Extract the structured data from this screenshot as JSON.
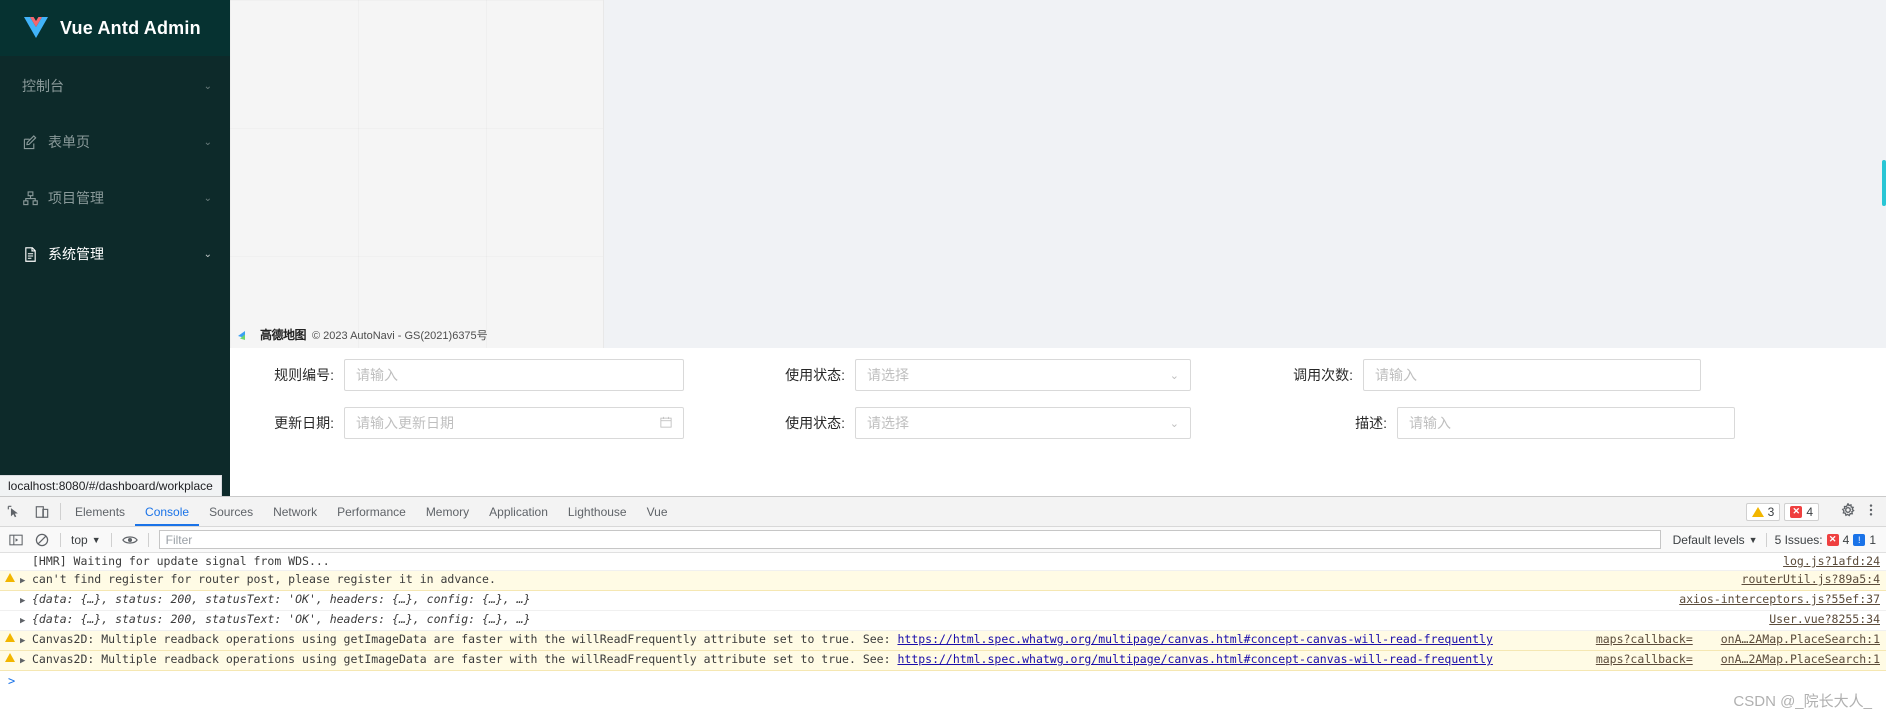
{
  "app": {
    "logo_title": "Vue Antd Admin",
    "logo_icon": "vue-logo-icon",
    "status_url": "localhost:8080/#/dashboard/workplace"
  },
  "sidebar": {
    "items": [
      {
        "label": "控制台",
        "icon": "",
        "arrow": "⌄",
        "active": false
      },
      {
        "label": "表单页",
        "icon": "edit-square-icon",
        "arrow": "⌄",
        "active": false
      },
      {
        "label": "项目管理",
        "icon": "cluster-icon",
        "arrow": "⌄",
        "active": false
      },
      {
        "label": "系统管理",
        "icon": "file-text-icon",
        "arrow": "⌄",
        "active": true
      }
    ]
  },
  "map": {
    "brand": "高德地图",
    "copyright": "© 2023 AutoNavi - GS(2021)6375号",
    "logo_icon": "amap-logo-icon"
  },
  "form": {
    "row1": [
      {
        "label": "规则编号:",
        "placeholder": "请输入",
        "type": "input"
      },
      {
        "label": "使用状态:",
        "placeholder": "请选择",
        "type": "select",
        "suffix_icon": "chevron-down-icon"
      },
      {
        "label": "调用次数:",
        "placeholder": "请输入",
        "type": "input"
      }
    ],
    "row2": [
      {
        "label": "更新日期:",
        "placeholder": "请输入更新日期",
        "type": "date",
        "suffix_icon": "calendar-icon"
      },
      {
        "label": "使用状态:",
        "placeholder": "请选择",
        "type": "select",
        "suffix_icon": "chevron-down-icon"
      },
      {
        "label": "描述:",
        "placeholder": "请输入",
        "type": "input"
      }
    ]
  },
  "devtools": {
    "inspect_icon": "inspect-element-icon",
    "device_icon": "device-toolbar-icon",
    "tabs": [
      {
        "label": "Elements",
        "active": false
      },
      {
        "label": "Console",
        "active": true
      },
      {
        "label": "Sources",
        "active": false
      },
      {
        "label": "Network",
        "active": false
      },
      {
        "label": "Performance",
        "active": false
      },
      {
        "label": "Memory",
        "active": false
      },
      {
        "label": "Application",
        "active": false
      },
      {
        "label": "Lighthouse",
        "active": false
      },
      {
        "label": "Vue",
        "active": false
      }
    ],
    "warning_count": "3",
    "error_count": "4",
    "error_glyph": "✕",
    "settings_icon": "gear-icon",
    "more_icon": "kebab-menu-icon",
    "toolbar": {
      "sidebar_icon": "console-sidebar-icon",
      "clear_icon": "clear-console-icon",
      "context": "top",
      "context_arrow": "▼",
      "eye_icon": "live-expression-eye-icon",
      "filter_placeholder": "Filter",
      "levels_label": "Default levels",
      "levels_arrow": "▼",
      "issues_label": "5 Issues:",
      "issues_error_count": "4",
      "issues_info_count": "1",
      "issues_error_glyph": "✕",
      "issues_info_glyph": "!"
    },
    "console_rows": [
      {
        "level": "plain",
        "arrow": "",
        "text": "[HMR] Waiting for update signal from WDS...",
        "source": "log.js?1afd:24"
      },
      {
        "level": "warn",
        "arrow": "▶",
        "text": "can't find register for router post, please register it in advance.",
        "source": "routerUtil.js?89a5:4"
      },
      {
        "level": "plain",
        "arrow": "▶",
        "text": "{data: {…}, status: 200, statusText: 'OK', headers: {…}, config: {…}, …}",
        "source": "axios-interceptors.js?55ef:37"
      },
      {
        "level": "plain",
        "arrow": "▶",
        "text": "{data: {…}, status: 200, statusText: 'OK', headers: {…}, config: {…}, …}",
        "source": "User.vue?8255:34"
      },
      {
        "level": "warn",
        "arrow": "▶",
        "text": "Canvas2D: Multiple readback operations using getImageData are faster with the willReadFrequently attribute set to true. See:",
        "link": "https://html.spec.whatwg.org/multipage/canvas.html#concept-canvas-will-read-frequently",
        "source_a": "maps?callback=",
        "source_b": "onA…2AMap.PlaceSearch:1"
      },
      {
        "level": "warn",
        "arrow": "▶",
        "text": "Canvas2D: Multiple readback operations using getImageData are faster with the willReadFrequently attribute set to true. See:",
        "link": "https://html.spec.whatwg.org/multipage/canvas.html#concept-canvas-will-read-frequently",
        "source_a": "maps?callback=",
        "source_b": "onA…2AMap.PlaceSearch:1"
      }
    ],
    "prompt_glyph": ">"
  },
  "watermark": "CSDN @_院长大人_",
  "colors": {
    "sidebar_bg": "#0d2a2a",
    "logo_bg": "#063231",
    "accent": "#1a73e8",
    "scroll_cyan": "#28c6d5"
  }
}
